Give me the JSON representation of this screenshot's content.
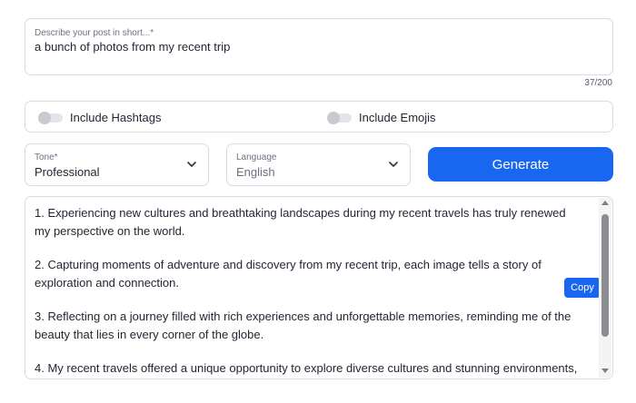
{
  "description": {
    "label": "Describe your post in short...*",
    "value": "a bunch of photos from my recent trip",
    "counter": "37/200"
  },
  "toggles": {
    "hashtags": {
      "label": "Include Hashtags",
      "on": false
    },
    "emojis": {
      "label": "Include Emojis",
      "on": false
    }
  },
  "tone": {
    "label": "Tone*",
    "value": "Professional"
  },
  "language": {
    "label": "Language",
    "value": "English"
  },
  "generate_label": "Generate",
  "copy_label": "Copy",
  "output": {
    "paragraphs": [
      "1. Experiencing new cultures and breathtaking landscapes during my recent travels has truly renewed my perspective on the world.",
      "2. Capturing moments of adventure and discovery from my recent trip, each image tells a story of exploration and connection.",
      "3. Reflecting on a journey filled with rich experiences and unforgettable memories, reminding me of the beauty that lies in every corner of the globe.",
      "4. My recent travels offered a unique opportunity to explore diverse cultures and stunning environments,"
    ]
  },
  "colors": {
    "accent": "#1967f0",
    "border": "#d8dbe1"
  },
  "icons": {
    "dropdown": "chevron-down-icon",
    "scroll_up": "arrow-up-icon",
    "scroll_down": "arrow-down-icon"
  }
}
